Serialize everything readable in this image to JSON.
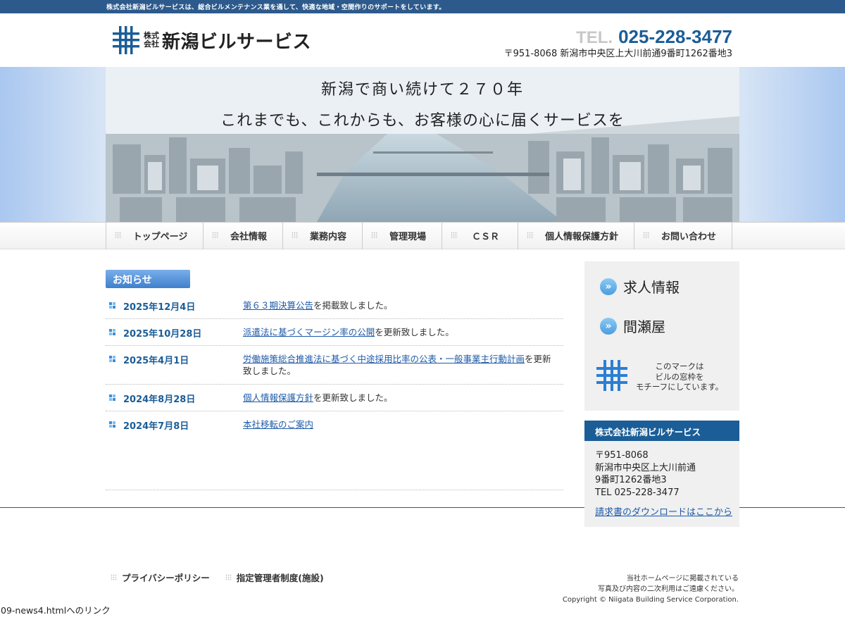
{
  "topbar": {
    "text": "株式会社新潟ビルサービスは、総合ビルメンテナンス業を通して、快適な地域・空間作りのサポートをしています。"
  },
  "header": {
    "logo_small_1": "株式",
    "logo_small_2": "会社",
    "logo_name": "新潟ビルサービス",
    "tel_label": "TEL.",
    "tel_number": "025-228-3477",
    "address": "〒951-8068 新潟市中央区上大川前通9番町1262番地3"
  },
  "hero": {
    "line1": "新潟で商い続けて２７０年",
    "line2": "これまでも、これからも、お客様の心に届くサービスを"
  },
  "nav": {
    "items": [
      {
        "label": "トップページ"
      },
      {
        "label": "会社情報"
      },
      {
        "label": "業務内容"
      },
      {
        "label": "管理現場"
      },
      {
        "label": "ＣＳＲ"
      },
      {
        "label": "個人情報保護方針"
      },
      {
        "label": "お問い合わせ"
      }
    ]
  },
  "news": {
    "heading": "お知らせ",
    "items": [
      {
        "date": "2025年12月4日",
        "link": "第６３期決算公告",
        "suffix": "を掲載致しました。"
      },
      {
        "date": "2025年10月28日",
        "link": "派遣法に基づくマージン率の公開",
        "suffix": "を更新致しました。"
      },
      {
        "date": "2025年4月1日",
        "link": "労働施策総合推進法に基づく中途採用比率の公表・一般事業主行動計画",
        "suffix": "を更新致しました。"
      },
      {
        "date": "2024年8月28日",
        "link": "個人情報保護方針",
        "suffix": "を更新致しました。"
      },
      {
        "date": "2024年7月8日",
        "link": "本社移転のご案内",
        "suffix": ""
      }
    ]
  },
  "sidebar": {
    "links": [
      {
        "label": "求人情報",
        "icon": "double-chevron-right-icon"
      },
      {
        "label": "間瀬屋",
        "icon": "double-chevron-right-icon"
      }
    ],
    "mark_note_1": "このマークは",
    "mark_note_2": "ビルの窓枠を",
    "mark_note_3": "モチーフにしています。"
  },
  "company": {
    "heading": "株式会社新潟ビルサービス",
    "postal": "〒951-8068",
    "address1": "新潟市中央区上大川前通",
    "address2": "9番町1262番地3",
    "tel": "TEL 025-228-3477",
    "download_link": "請求書のダウンロードはここから"
  },
  "footer": {
    "links": [
      {
        "label": "プライバシーポリシー"
      },
      {
        "label": "指定管理者制度(施設)"
      }
    ],
    "note1": "当社ホームページに掲載されている",
    "note2": "写真及び内容の二次利用はご遠慮ください。",
    "copyright": "Copyright © Niigata Building Service Corporation."
  },
  "status_bar": {
    "text": "09-news4.htmlへのリンク"
  },
  "colors": {
    "brand_blue": "#1b5d97",
    "topbar": "#2d5a8c",
    "link": "#1e5aa8"
  }
}
